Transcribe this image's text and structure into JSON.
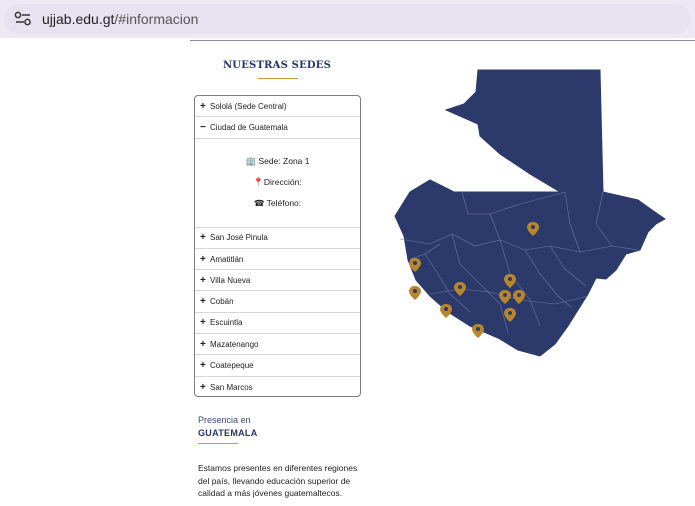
{
  "browser": {
    "url_host": "ujjab.edu.gt",
    "url_path": "/#informacion"
  },
  "sedes": {
    "title": "NUESTRAS SEDES",
    "items": [
      {
        "sign": "+",
        "label": "Sololá (Sede Central)"
      },
      {
        "sign": "−",
        "label": "Ciudad de Guatemala"
      },
      {
        "sign": "+",
        "label": "San José Pinula"
      },
      {
        "sign": "+",
        "label": "Amatitlán"
      },
      {
        "sign": "+",
        "label": "Villa Nueva"
      },
      {
        "sign": "+",
        "label": "Cobán"
      },
      {
        "sign": "+",
        "label": "Escuintla"
      },
      {
        "sign": "+",
        "label": "Mazatenango"
      },
      {
        "sign": "+",
        "label": "Coatepeque"
      },
      {
        "sign": "+",
        "label": "San Marcos"
      }
    ],
    "expanded": {
      "sede": "🏢 Sede: Zona 1",
      "direccion": "📍Dirección:",
      "telefono": "☎ Teléfono:"
    }
  },
  "presence": {
    "small": "Presencia en",
    "big": "GUATEMALA",
    "description": "Estamos presentes en diferentes regiones del país, llevando educación superior de calidad a más jóvenes guatemaltecos."
  },
  "colors": {
    "navy": "#2c3a6b",
    "gold": "#c49a3c",
    "pin": "#b8872c"
  }
}
